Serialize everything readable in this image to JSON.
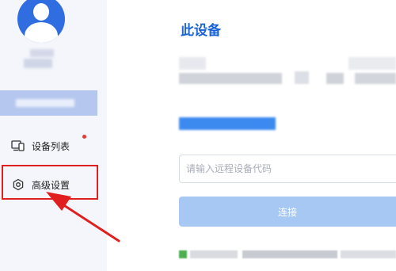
{
  "sidebar": {
    "nav": [
      {
        "label": "设备列表",
        "icon": "devices-icon",
        "badge": true
      },
      {
        "label": "高级设置",
        "icon": "settings-icon",
        "badge": false
      }
    ]
  },
  "main": {
    "title": "此设备",
    "remote_input": {
      "placeholder": "请输入远程设备代码",
      "value": ""
    },
    "connect_label": "连接"
  },
  "colors": {
    "brand": "#1a63d6",
    "avatar": "#2f6de0",
    "connect_button": "#a8c8f4",
    "highlight": "#e02020",
    "badge": "#e53935"
  }
}
